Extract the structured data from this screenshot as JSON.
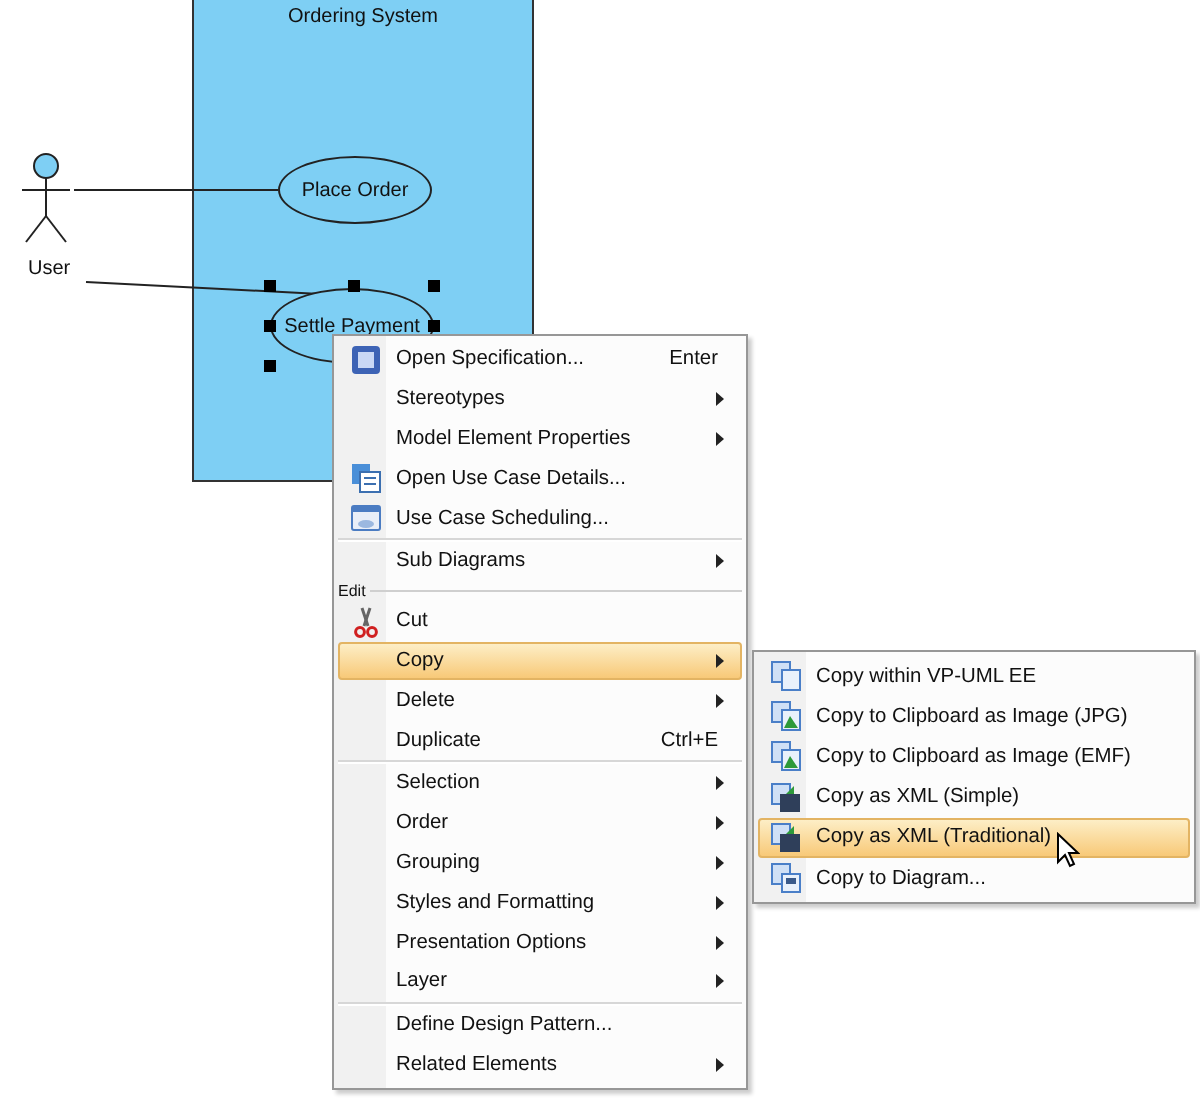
{
  "diagram": {
    "system_title": "Ordering System",
    "actor": {
      "name": "User"
    },
    "use_cases": [
      {
        "name": "Place Order",
        "selected": false
      },
      {
        "name": "Settle Payment",
        "selected": true
      }
    ]
  },
  "context_menu": {
    "items": [
      {
        "kind": "item",
        "label": "Open Specification...",
        "shortcut": "Enter",
        "has_submenu": false,
        "selected": false
      },
      {
        "kind": "item",
        "label": "Stereotypes",
        "has_submenu": true,
        "selected": false
      },
      {
        "kind": "item",
        "label": "Model Element Properties",
        "has_submenu": true,
        "selected": false
      },
      {
        "kind": "item",
        "label": "Open Use Case Details...",
        "has_submenu": false,
        "selected": false
      },
      {
        "kind": "item",
        "label": "Use Case Scheduling...",
        "has_submenu": false,
        "selected": false
      },
      {
        "kind": "separator"
      },
      {
        "kind": "item",
        "label": "Sub Diagrams",
        "has_submenu": true,
        "selected": false
      },
      {
        "kind": "group",
        "label": "Edit"
      },
      {
        "kind": "item",
        "label": "Cut",
        "has_submenu": false,
        "selected": false
      },
      {
        "kind": "item",
        "label": "Copy",
        "has_submenu": true,
        "selected": true
      },
      {
        "kind": "item",
        "label": "Delete",
        "has_submenu": true,
        "selected": false
      },
      {
        "kind": "item",
        "label": "Duplicate",
        "shortcut": "Ctrl+E",
        "has_submenu": false,
        "selected": false
      },
      {
        "kind": "separator"
      },
      {
        "kind": "item",
        "label": "Selection",
        "has_submenu": true,
        "selected": false
      },
      {
        "kind": "item",
        "label": "Order",
        "has_submenu": true,
        "selected": false
      },
      {
        "kind": "item",
        "label": "Grouping",
        "has_submenu": true,
        "selected": false
      },
      {
        "kind": "item",
        "label": "Styles and Formatting",
        "has_submenu": true,
        "selected": false
      },
      {
        "kind": "item",
        "label": "Presentation Options",
        "has_submenu": true,
        "selected": false
      },
      {
        "kind": "item",
        "label": "Layer",
        "has_submenu": true,
        "selected": false
      },
      {
        "kind": "separator"
      },
      {
        "kind": "item",
        "label": "Define Design Pattern...",
        "has_submenu": false,
        "selected": false
      },
      {
        "kind": "item",
        "label": "Related Elements",
        "has_submenu": true,
        "selected": false
      }
    ]
  },
  "copy_submenu": {
    "items": [
      {
        "label": "Copy within VP-UML EE",
        "selected": false
      },
      {
        "label": "Copy to Clipboard as Image (JPG)",
        "selected": false
      },
      {
        "label": "Copy to Clipboard as Image (EMF)",
        "selected": false
      },
      {
        "label": "Copy as XML (Simple)",
        "selected": false
      },
      {
        "label": "Copy as XML (Traditional)",
        "selected": true
      },
      {
        "label": "Copy to Diagram...",
        "selected": false
      }
    ]
  }
}
